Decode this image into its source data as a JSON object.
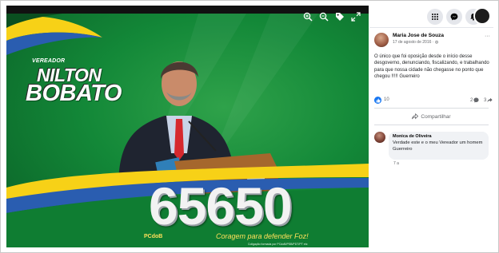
{
  "viewer": {
    "tools": [
      {
        "icon": "zoom-in-icon",
        "label": "⊕"
      },
      {
        "icon": "zoom-out-icon",
        "label": "⊖"
      },
      {
        "icon": "tag-icon",
        "label": ""
      },
      {
        "icon": "fullscreen-icon",
        "label": "⤢"
      }
    ],
    "poster": {
      "role": "VEREADOR",
      "first_name": "NILTON",
      "last_name": "BOBATO",
      "number": "65650",
      "party": "PCdoB",
      "slogan": "Coragem para defender Foz!",
      "fineprint": "Coligação formada por PCdoB/PSB/PDT/PT etc"
    },
    "colors": {
      "green": "#138838",
      "yellow": "#f7d117",
      "blue": "#2a5db0"
    }
  },
  "nav": {
    "icons": [
      "menu-grid-icon",
      "messenger-icon",
      "notifications-icon",
      "profile-avatar"
    ]
  },
  "post": {
    "author": "Maria Jose de Souza",
    "date": "17 de agosto de 2016 · ",
    "privacy_icon": "globe-icon",
    "more": "···",
    "text": "O único que foi oposição desde o início desse desgoverno, denunciando, fiscalizando, e trabalhando para que nossa cidade não chegasse no ponto que chegou !!!!! Guerreiro",
    "likes": "10",
    "comments": "2",
    "shares": "3",
    "share_label": "Compartilhar"
  },
  "comment": {
    "author": "Monica de Oliveira",
    "text": "Verdade este e o meu Vereador um homem Guerreiro",
    "time": "7 a"
  }
}
